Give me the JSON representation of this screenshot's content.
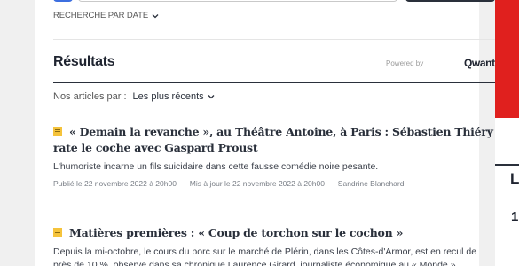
{
  "search": {
    "date_search_label": "RECHERCHE PAR DATE"
  },
  "results": {
    "title": "Résultats",
    "powered_by": "Powered by",
    "engine": "Qwant"
  },
  "sort": {
    "label": "Nos articles par :",
    "selected": "Les plus récents"
  },
  "articles": [
    {
      "title": "« Demain la revanche », au Théâtre Antoine, à Paris : Sébastien Thiéry rate le coche avec Gaspard Proust",
      "description": "L'humoriste incarne un fils suicidaire dans cette fausse comédie noire pesante.",
      "published": "Publié le 22 novembre 2022 à 20h00",
      "updated": "Mis à jour le 22 novembre 2022 à 20h00",
      "author": "Sandrine Blanchard"
    },
    {
      "title": "Matières premières : « Coup de torchon sur le cochon »",
      "description": "Depuis la mi-octobre, le cours du porc sur le marché de Plérin, dans les Côtes-d'Armor, est en recul de près de 10 %, observe dans sa chronique Laurence Girard, journaliste économique au « Monde »."
    }
  ],
  "right_panel": {
    "letter_1": "L",
    "letter_2": "1"
  },
  "colors": {
    "accent_red": "#e0201e",
    "dark": "#2a303b",
    "icon_yellow": "#f5c33b",
    "blue_button": "#3d6fe0"
  },
  "icons": {
    "date_chevron": "chevron-down-icon",
    "sort_chevron": "chevron-down-icon",
    "article_icon": "article-icon"
  }
}
